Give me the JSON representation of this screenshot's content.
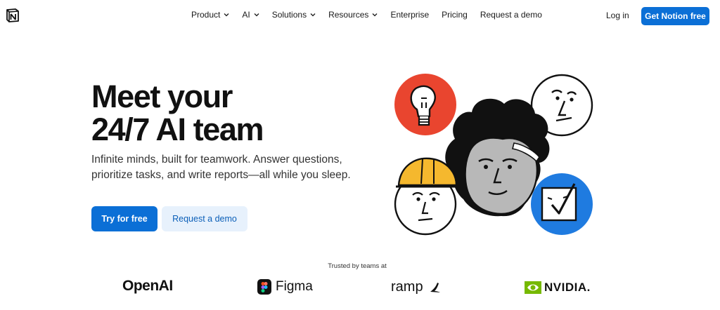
{
  "nav": {
    "items": [
      {
        "label": "Product",
        "dropdown": true
      },
      {
        "label": "AI",
        "dropdown": true
      },
      {
        "label": "Solutions",
        "dropdown": true
      },
      {
        "label": "Resources",
        "dropdown": true
      },
      {
        "label": "Enterprise",
        "dropdown": false
      },
      {
        "label": "Pricing",
        "dropdown": false
      },
      {
        "label": "Request a demo",
        "dropdown": false
      }
    ],
    "login": "Log in",
    "cta": "Get Notion free"
  },
  "hero": {
    "title_line1": "Meet your",
    "title_line2": "24/7 AI team",
    "subtitle": "Infinite minds, built for teamwork. Answer questions, prioritize tasks, and write reports—all while you sleep.",
    "primary_button": "Try for free",
    "secondary_button": "Request a demo"
  },
  "trusted": {
    "label": "Trusted by teams at",
    "logos": [
      "OpenAI",
      "Figma",
      "ramp",
      "NVIDIA."
    ]
  },
  "colors": {
    "accent": "#0b6fd6",
    "accent_light": "#e7f1fc",
    "bulb_circle": "#e9452f",
    "check_circle": "#1f7be0",
    "hard_hat": "#f5b82e"
  },
  "icons": {
    "logo": "notion-logo-icon",
    "chevron": "chevron-down-icon"
  }
}
